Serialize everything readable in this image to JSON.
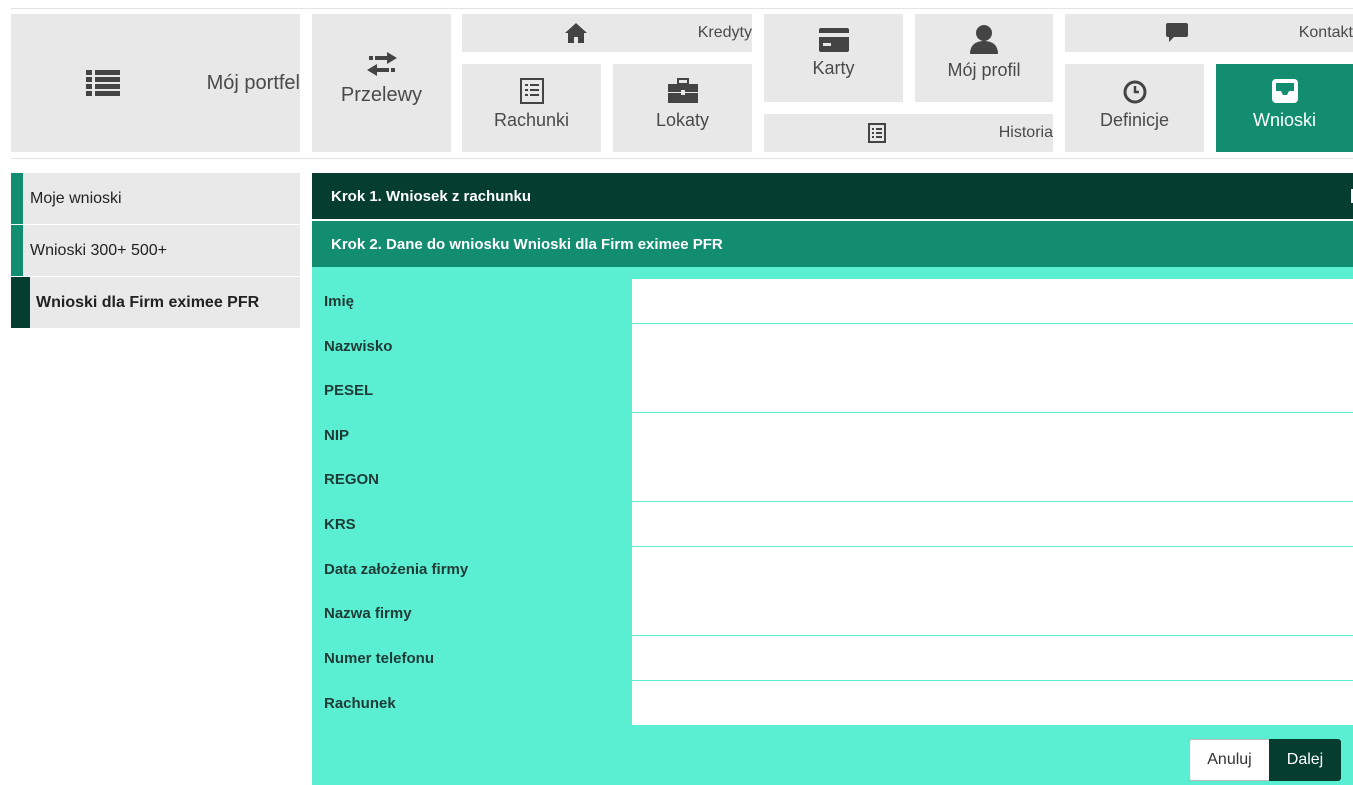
{
  "nav": {
    "portfel": "Mój portfel",
    "przelewy": "Przelewy",
    "kredyty": "Kredyty",
    "rachunki": "Rachunki",
    "lokaty": "Lokaty",
    "karty": "Karty",
    "profil": "Mój profil",
    "historia": "Historia",
    "kontakt": "Kontakt",
    "definicje": "Definicje",
    "wnioski": "Wnioski"
  },
  "sidebar": {
    "items": [
      {
        "label": "Moje wnioski"
      },
      {
        "label": "Wnioski 300+ 500+"
      },
      {
        "label": "Wnioski dla Firm eximee PFR"
      }
    ]
  },
  "steps": {
    "step1": "Krok 1. Wniosek z rachunku",
    "step2": "Krok 2. Dane do wniosku Wnioski dla Firm eximee PFR"
  },
  "form": {
    "fields": [
      {
        "label": "Imię",
        "value": ""
      },
      {
        "label": "Nazwisko",
        "value": ""
      },
      {
        "label": "PESEL",
        "value": ""
      },
      {
        "label": "NIP",
        "value": ""
      },
      {
        "label": "REGON",
        "value": ""
      },
      {
        "label": "KRS",
        "value": ""
      },
      {
        "label": "Data założenia firmy",
        "value": ""
      },
      {
        "label": "Nazwa firmy",
        "value": ""
      },
      {
        "label": "Numer telefonu",
        "value": ""
      },
      {
        "label": "Rachunek",
        "value": ""
      }
    ]
  },
  "buttons": {
    "cancel": "Anuluj",
    "next": "Dalej"
  },
  "colors": {
    "tile_bg": "#e8e8e8",
    "accent": "#138d70",
    "dark": "#063d31",
    "form_bg": "#5aeed3"
  }
}
